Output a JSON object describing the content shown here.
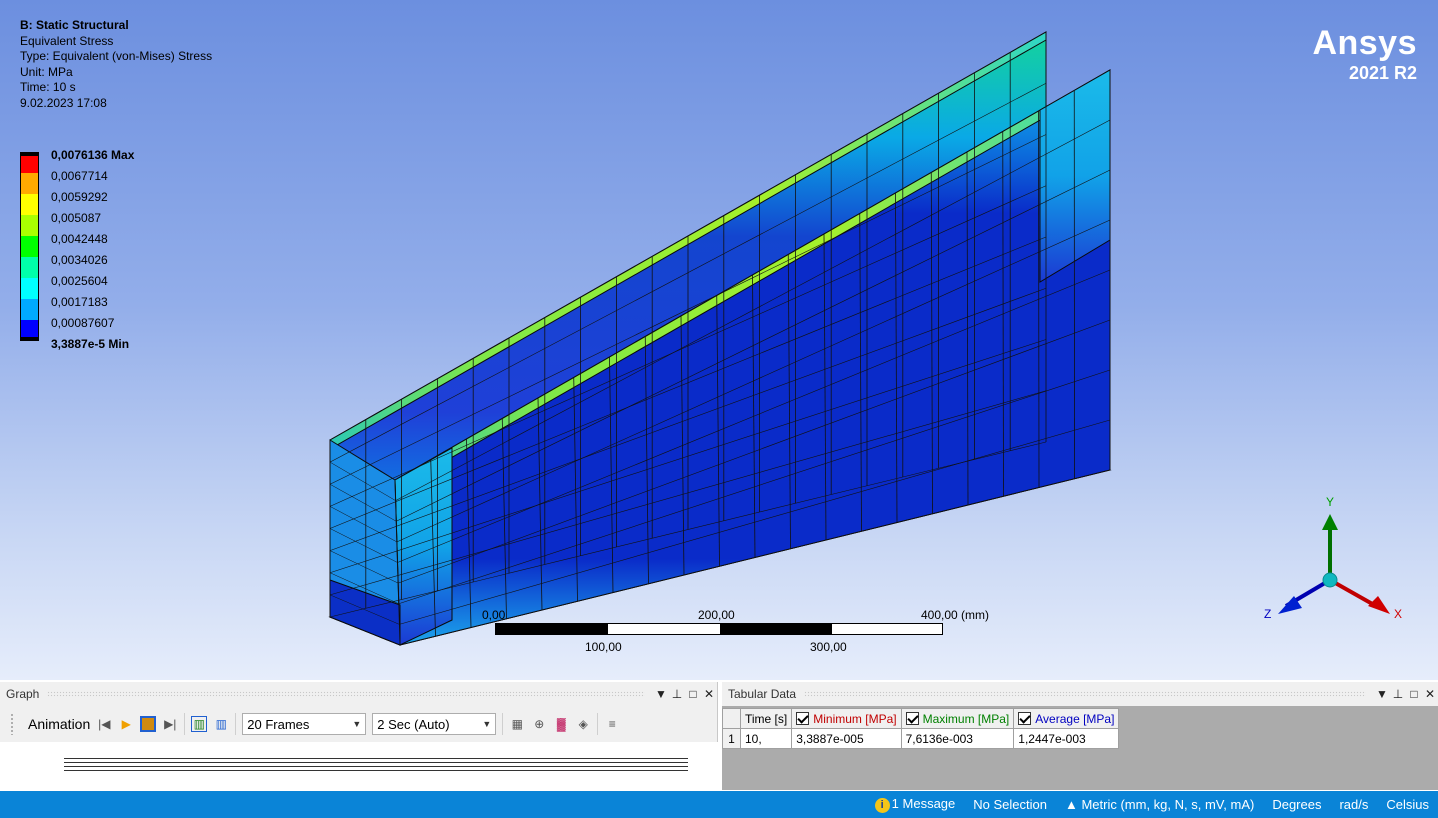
{
  "info": {
    "system": "B: Static Structural",
    "result": "Equivalent Stress",
    "type": "Type: Equivalent (von-Mises) Stress",
    "unit": "Unit: MPa",
    "time": "Time: 10 s",
    "date": "9.02.2023 17:08"
  },
  "legend": {
    "max_label": "0,0076136 Max",
    "levels": [
      "0,0067714",
      "0,0059292",
      "0,005087",
      "0,0042448",
      "0,0034026",
      "0,0025604",
      "0,0017183",
      "0,00087607"
    ],
    "min_label": "3,3887e-5 Min",
    "colors": [
      "#ff0000",
      "#ffaa00",
      "#ffff00",
      "#aaff00",
      "#00ff00",
      "#00ffaa",
      "#00ffff",
      "#00aaff",
      "#0000ff"
    ]
  },
  "logo": {
    "brand": "Ansys",
    "version": "2021 R2"
  },
  "scale": {
    "l0": "0,00",
    "l200": "200,00",
    "l400": "400,00 (mm)",
    "l100": "100,00",
    "l300": "300,00"
  },
  "triad": {
    "y": "Y",
    "z": "Z",
    "x": "X"
  },
  "graph": {
    "title": "Graph",
    "animation_label": "Animation",
    "frames": "20 Frames",
    "duration": "2 Sec (Auto)"
  },
  "tabular": {
    "title": "Tabular Data",
    "headers": [
      "Time [s]",
      "Minimum [MPa]",
      "Maximum [MPa]",
      "Average [MPa]"
    ],
    "header_colors": [
      "#000000",
      "#c00000",
      "#008000",
      "#0000c0"
    ],
    "rows": [
      {
        "n": "1",
        "cells": [
          "10,",
          "3,3887e-005",
          "7,6136e-003",
          "1,2447e-003"
        ]
      }
    ]
  },
  "status": {
    "messages": "1 Message",
    "selection": "No Selection",
    "units": "Metric (mm, kg, N, s, mV, mA)",
    "angle": "Degrees",
    "rate": "rad/s",
    "temp": "Celsius"
  }
}
